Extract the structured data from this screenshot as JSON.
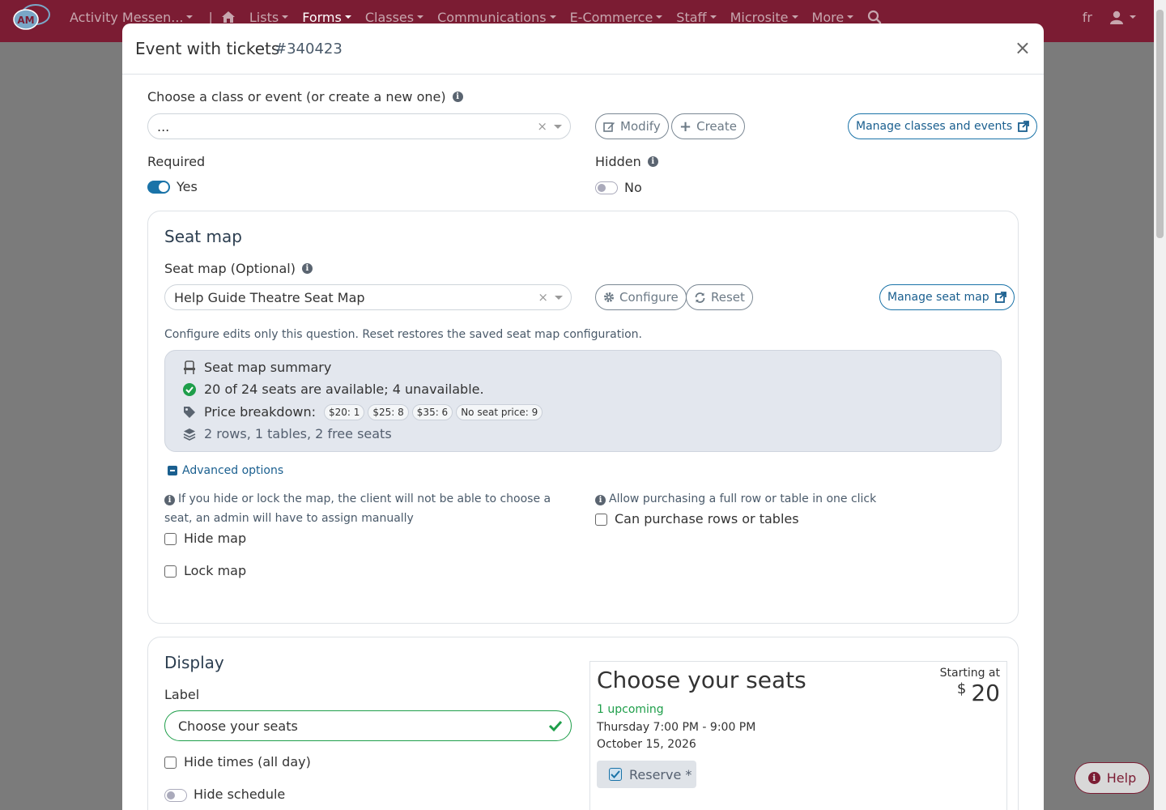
{
  "nav": {
    "app_name": "Activity Messen...",
    "items": [
      "Lists",
      "Forms",
      "Classes",
      "Communications",
      "E-Commerce",
      "Staff",
      "Microsite",
      "More"
    ],
    "active_index": 1,
    "lang": "fr",
    "logo_text": "AM"
  },
  "modal": {
    "title": "Event with tickets",
    "id": "#340423",
    "close": "×",
    "choose_label": "Choose a class or event (or create a new one)",
    "choose_value": "...",
    "modify_label": "Modify",
    "create_label": "Create",
    "manage_events_label": "Manage classes and events",
    "required_label": "Required",
    "required_value": "Yes",
    "hidden_label": "Hidden",
    "hidden_value": "No"
  },
  "seatmap": {
    "title": "Seat map",
    "field_label": "Seat map (Optional)",
    "value": "Help Guide Theatre Seat Map",
    "configure_label": "Configure",
    "reset_label": "Reset",
    "manage_label": "Manage seat map",
    "help": "Configure edits only this question. Reset restores the saved seat map configuration.",
    "summary_title": "Seat map summary",
    "availability": "20 of 24 seats are available; 4 unavailable.",
    "price_label": "Price breakdown:",
    "prices": [
      "$20: 1",
      "$25: 8",
      "$35: 6",
      "No seat price: 9"
    ],
    "layout": "2 rows, 1 tables, 2 free seats",
    "advanced_label": "Advanced options",
    "hide_lock_help": "If you hide or lock the map, the client will not be able to choose a seat, an admin will have to assign manually",
    "hide_map": "Hide map",
    "lock_map": "Lock map",
    "purchase_help": "Allow purchasing a full row or table in one click",
    "purchase_rows": "Can purchase rows or tables"
  },
  "display": {
    "title": "Display",
    "label_label": "Label",
    "label_value": "Choose your seats",
    "hide_times": "Hide times (all day)",
    "hide_schedule": "Hide schedule",
    "preview": {
      "title": "Choose your seats",
      "starting_at": "Starting at",
      "currency": "$",
      "price": "20",
      "upcoming": "1 upcoming",
      "time": "Thursday 7:00 PM - 9:00 PM",
      "date": "October 15, 2026",
      "reserve": "Reserve *"
    }
  },
  "help_button": "Help",
  "colors": {
    "brand": "#7b1c33",
    "primary": "#1a73a8",
    "success": "#1e9e4a"
  }
}
